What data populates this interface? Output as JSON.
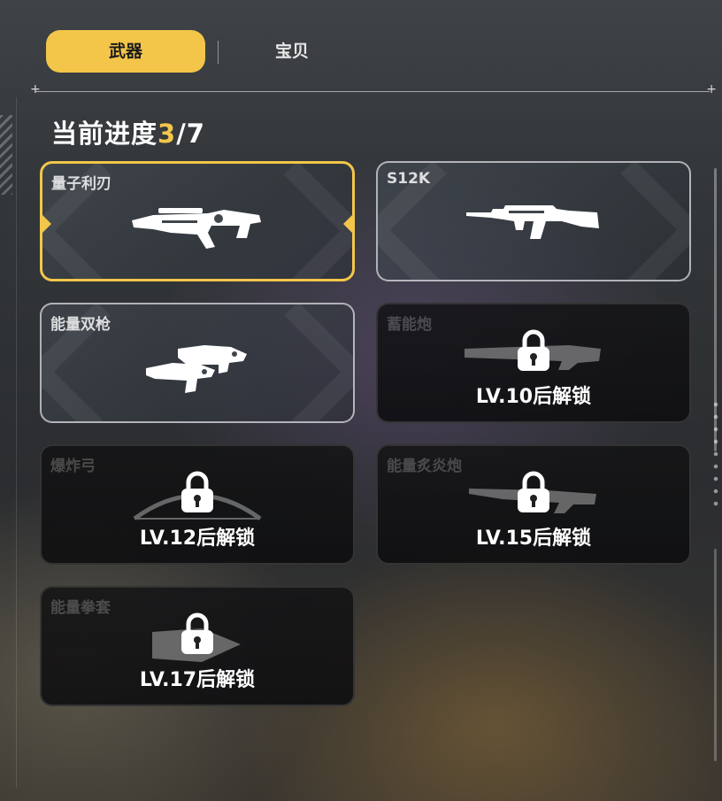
{
  "tabs": [
    {
      "label": "武器",
      "active": true
    },
    {
      "label": "宝贝",
      "active": false
    }
  ],
  "progress": {
    "label": "当前进度",
    "current": "3",
    "total": "/7"
  },
  "weapons": [
    {
      "name": "量子利刃",
      "icon": "quantum-blade-gun-icon",
      "status": "selected"
    },
    {
      "name": "S12K",
      "icon": "assault-rifle-icon",
      "status": "unlocked"
    },
    {
      "name": "能量双枪",
      "icon": "dual-pistols-icon",
      "status": "unlocked"
    },
    {
      "name": "蓄能炮",
      "icon": "charge-cannon-icon",
      "status": "locked",
      "unlock": "LV.10后解锁"
    },
    {
      "name": "爆炸弓",
      "icon": "explosive-bow-icon",
      "status": "locked",
      "unlock": "LV.12后解锁"
    },
    {
      "name": "能量炙炎炮",
      "icon": "flame-cannon-icon",
      "status": "locked",
      "unlock": "LV.15后解锁"
    },
    {
      "name": "能量拳套",
      "icon": "energy-gauntlet-icon",
      "status": "locked",
      "unlock": "LV.17后解锁"
    }
  ],
  "colors": {
    "accent": "#f3c64a",
    "locked_bg": "#141416"
  }
}
